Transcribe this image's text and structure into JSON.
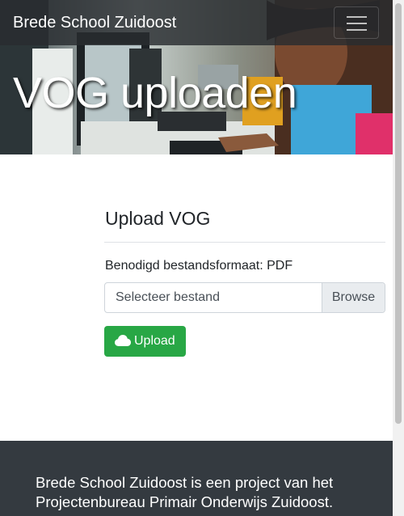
{
  "navbar": {
    "brand": "Brede School Zuidoost",
    "menu_toggle_icon": "hamburger-icon"
  },
  "hero": {
    "title": "VOG uploaden",
    "image": "photo of children working at computers"
  },
  "upload": {
    "heading": "Upload VOG",
    "format_note": "Benodigd bestandsformaat: PDF",
    "file_placeholder": "Selecteer bestand",
    "browse_label": "Browse",
    "button_label": "Upload",
    "button_icon": "cloud-upload-icon"
  },
  "footer": {
    "text": "Brede School Zuidoost is een project van het Projectenbureau Primair Onderwijs Zuidoost."
  },
  "colors": {
    "navbar_bg": "#343a40",
    "upload_button": "#28a745",
    "footer_bg": "#343a40"
  }
}
